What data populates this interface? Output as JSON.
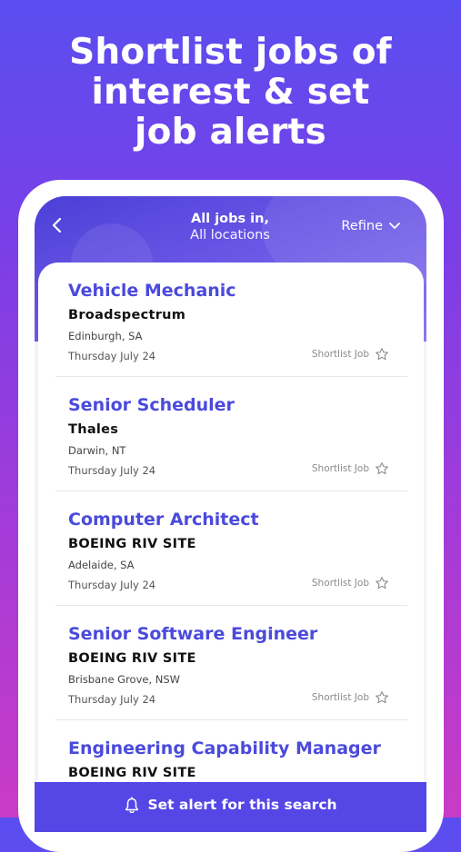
{
  "headline": {
    "line1": "Shortlist jobs of",
    "line2": "interest & set",
    "line3": "job alerts"
  },
  "header": {
    "back_icon": "chevron-left-icon",
    "title_line1": "All jobs in,",
    "title_line2": "All locations",
    "refine_label": "Refine",
    "refine_icon": "chevron-down-icon"
  },
  "jobs": [
    {
      "title": "Vehicle Mechanic",
      "company": "Broadspectrum",
      "location": "Edinburgh, SA",
      "date": "Thursday July 24",
      "shortlist_label": "Shortlist Job"
    },
    {
      "title": "Senior Scheduler",
      "company": "Thales",
      "location": "Darwin, NT",
      "date": "Thursday July 24",
      "shortlist_label": "Shortlist Job"
    },
    {
      "title": "Computer Architect",
      "company": "BOEING RIV SITE",
      "location": "Adelaide, SA",
      "date": "Thursday July 24",
      "shortlist_label": "Shortlist Job"
    },
    {
      "title": "Senior Software Engineer",
      "company": "BOEING RIV SITE",
      "location": "Brisbane Grove, NSW",
      "date": "Thursday July 24",
      "shortlist_label": "Shortlist Job"
    },
    {
      "title": "Engineering Capability Manager",
      "company": "BOEING RIV SITE"
    }
  ],
  "alert_bar": {
    "icon": "bell-icon",
    "label": "Set alert for this search"
  },
  "colors": {
    "accent": "#4a4adc",
    "alert_bar": "#5546e6",
    "background_top": "#5a4ef0",
    "background_bottom": "#c93bc6"
  }
}
